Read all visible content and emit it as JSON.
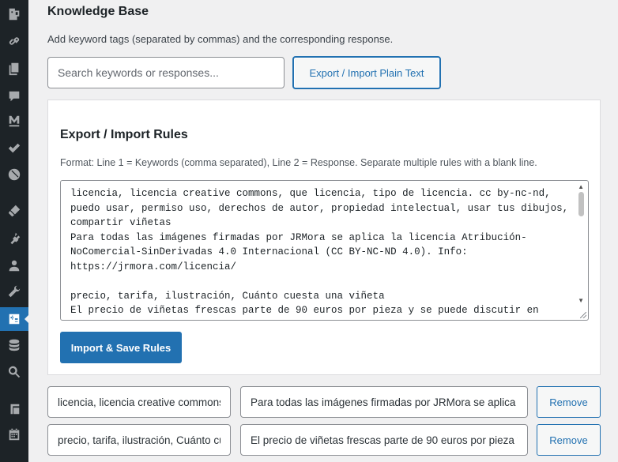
{
  "sidebar": {
    "items": [
      {
        "icon": "posts-icon"
      },
      {
        "icon": "link-icon"
      },
      {
        "icon": "pages-icon"
      },
      {
        "icon": "comments-icon"
      },
      {
        "icon": "m-logo-icon"
      },
      {
        "icon": "check-icon"
      },
      {
        "icon": "block-icon"
      },
      {
        "icon": "appearance-icon"
      },
      {
        "icon": "plugins-icon"
      },
      {
        "icon": "users-icon"
      },
      {
        "icon": "tools-icon"
      },
      {
        "icon": "chatbot-icon",
        "active": true
      },
      {
        "icon": "database-icon"
      },
      {
        "icon": "search-icon"
      },
      {
        "icon": "layers-icon"
      },
      {
        "icon": "calendar-icon"
      }
    ],
    "colors": {
      "background": "#1d2327",
      "icon": "#a7aaad",
      "active": "#2271b1"
    }
  },
  "header": {
    "title": "Knowledge Base",
    "description": "Add keyword tags (separated by commas) and the corresponding response."
  },
  "search": {
    "placeholder": "Search keywords or responses...",
    "value": ""
  },
  "toolbar": {
    "export_toggle_label": "Export / Import Plain Text"
  },
  "export_panel": {
    "title": "Export / Import Rules",
    "format_hint": "Format: Line 1 = Keywords (comma separated), Line 2 = Response. Separate multiple rules with a blank line.",
    "rules_text": "licencia, licencia creative commons, que licencia, tipo de licencia. cc by-nc-nd, puedo usar, permiso uso, derechos de autor, propiedad intelectual, usar tus dibujos, compartir viñetas\nPara todas las imágenes firmadas por JRMora se aplica la licencia Atribución-NoComercial-SinDerivadas 4.0 Internacional (CC BY-NC-ND 4.0). Info: https://jrmora.com/licencia/\n\nprecio, tarifa, ilustración, Cuánto cuesta una viñeta\nEl precio de viñetas frescas parte de 90 euros por pieza y se puede discutir en función",
    "import_button_label": "Import & Save Rules"
  },
  "rules": [
    {
      "keywords": "licencia, licencia creative commons, que licencia, tipo de licencia. cc by-nc-nd, puedo usar, permiso uso, derechos de autor, propiedad intelectual, usar tus dibujos, compartir viñetas",
      "response": "Para todas las imágenes firmadas por JRMora se aplica la licencia Atribución-NoComercial-SinDerivadas 4.0 Internacional (CC BY-NC-ND 4.0). Info: https://jrmora.com/licencia/",
      "remove_label": "Remove"
    },
    {
      "keywords": "precio, tarifa, ilustración, Cuánto cuesta una viñeta",
      "response": "El precio de viñetas frescas parte de 90 euros por pieza y se puede discutir en función",
      "remove_label": "Remove"
    }
  ],
  "colors": {
    "accent": "#2271b1",
    "page_bg": "#f0f0f1",
    "text": "#1d2327"
  }
}
